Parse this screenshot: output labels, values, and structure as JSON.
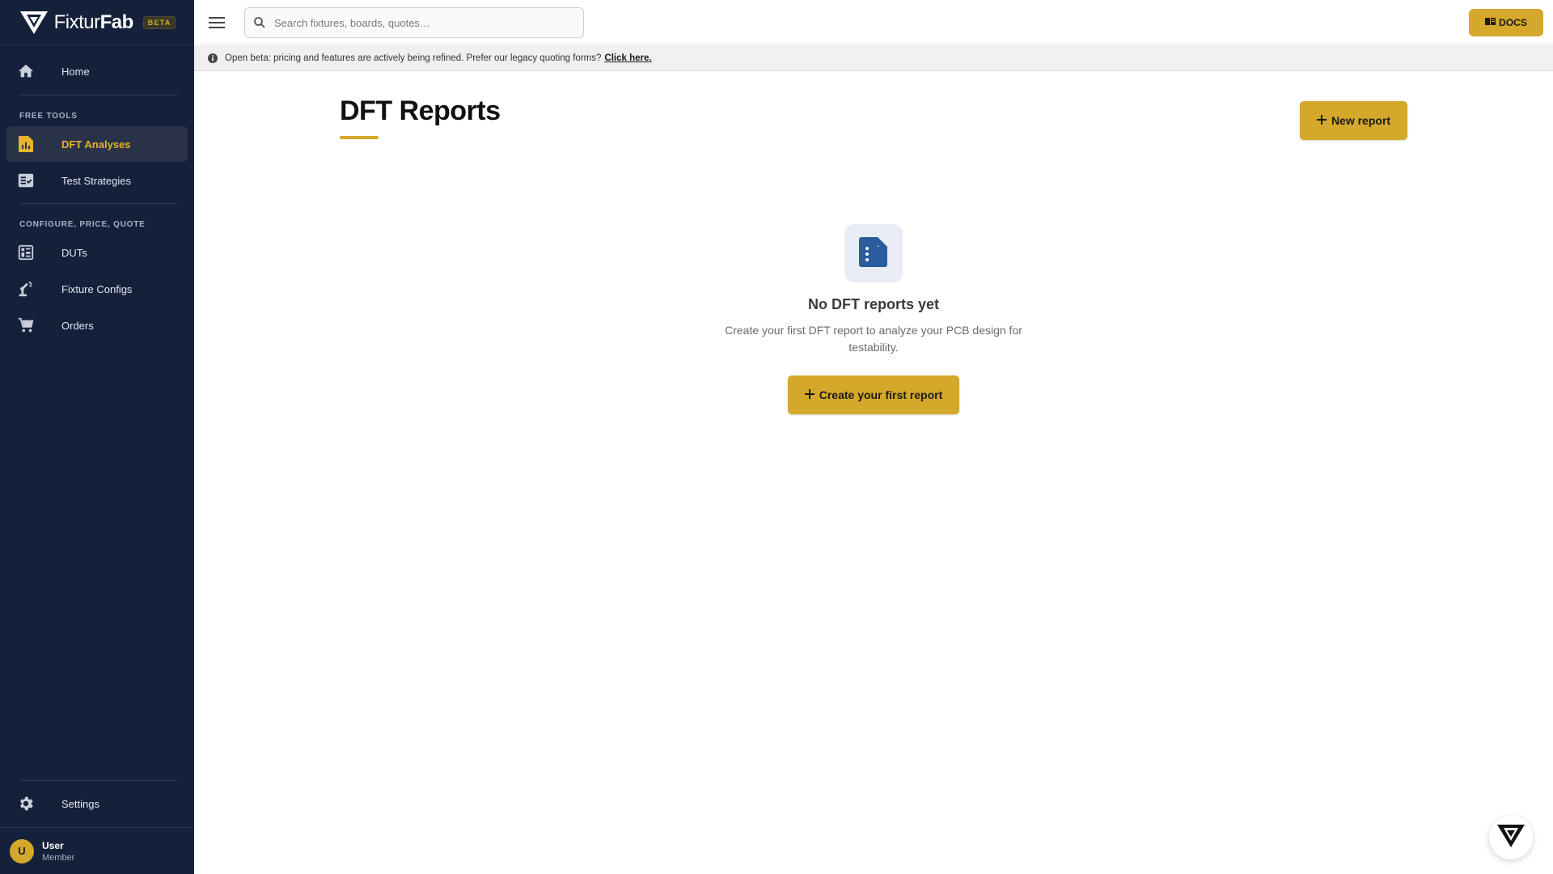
{
  "brand": {
    "name_bold": "Fixtur",
    "name_rest": "Fab",
    "badge": "BETA"
  },
  "sidebar": {
    "items": [
      {
        "label": "Home",
        "icon": "home-icon"
      },
      {
        "label": "DFT Analyses",
        "icon": "document-chart-icon",
        "active": true
      },
      {
        "label": "Test Strategies",
        "icon": "checklist-icon"
      },
      {
        "label": "DUTs",
        "icon": "board-icon"
      },
      {
        "label": "Fixture Configs",
        "icon": "robot-arm-icon"
      },
      {
        "label": "Orders",
        "icon": "cart-icon"
      },
      {
        "label": "Settings",
        "icon": "gear-icon"
      }
    ],
    "sections": {
      "free_tools": "FREE TOOLS",
      "cpq": "CONFIGURE, PRICE, QUOTE"
    }
  },
  "user": {
    "initial": "U",
    "name": "User",
    "role": "Member"
  },
  "header": {
    "search_placeholder": "Search fixtures, boards, quotes…",
    "docs_label": "DOCS"
  },
  "banner": {
    "text": "Open beta: pricing and features are actively being refined. Prefer our legacy quoting forms?",
    "link": "Click here."
  },
  "main": {
    "title": "DFT Reports",
    "new_button": "New report",
    "empty_title": "No DFT reports yet",
    "empty_subtitle": "Create your first DFT report to analyze your PCB design for testability.",
    "create_button": "Create your first report"
  },
  "colors": {
    "accent": "#d4a82a",
    "sidebar_bg": "#15203a",
    "icon_blue": "#2b5c9e"
  }
}
